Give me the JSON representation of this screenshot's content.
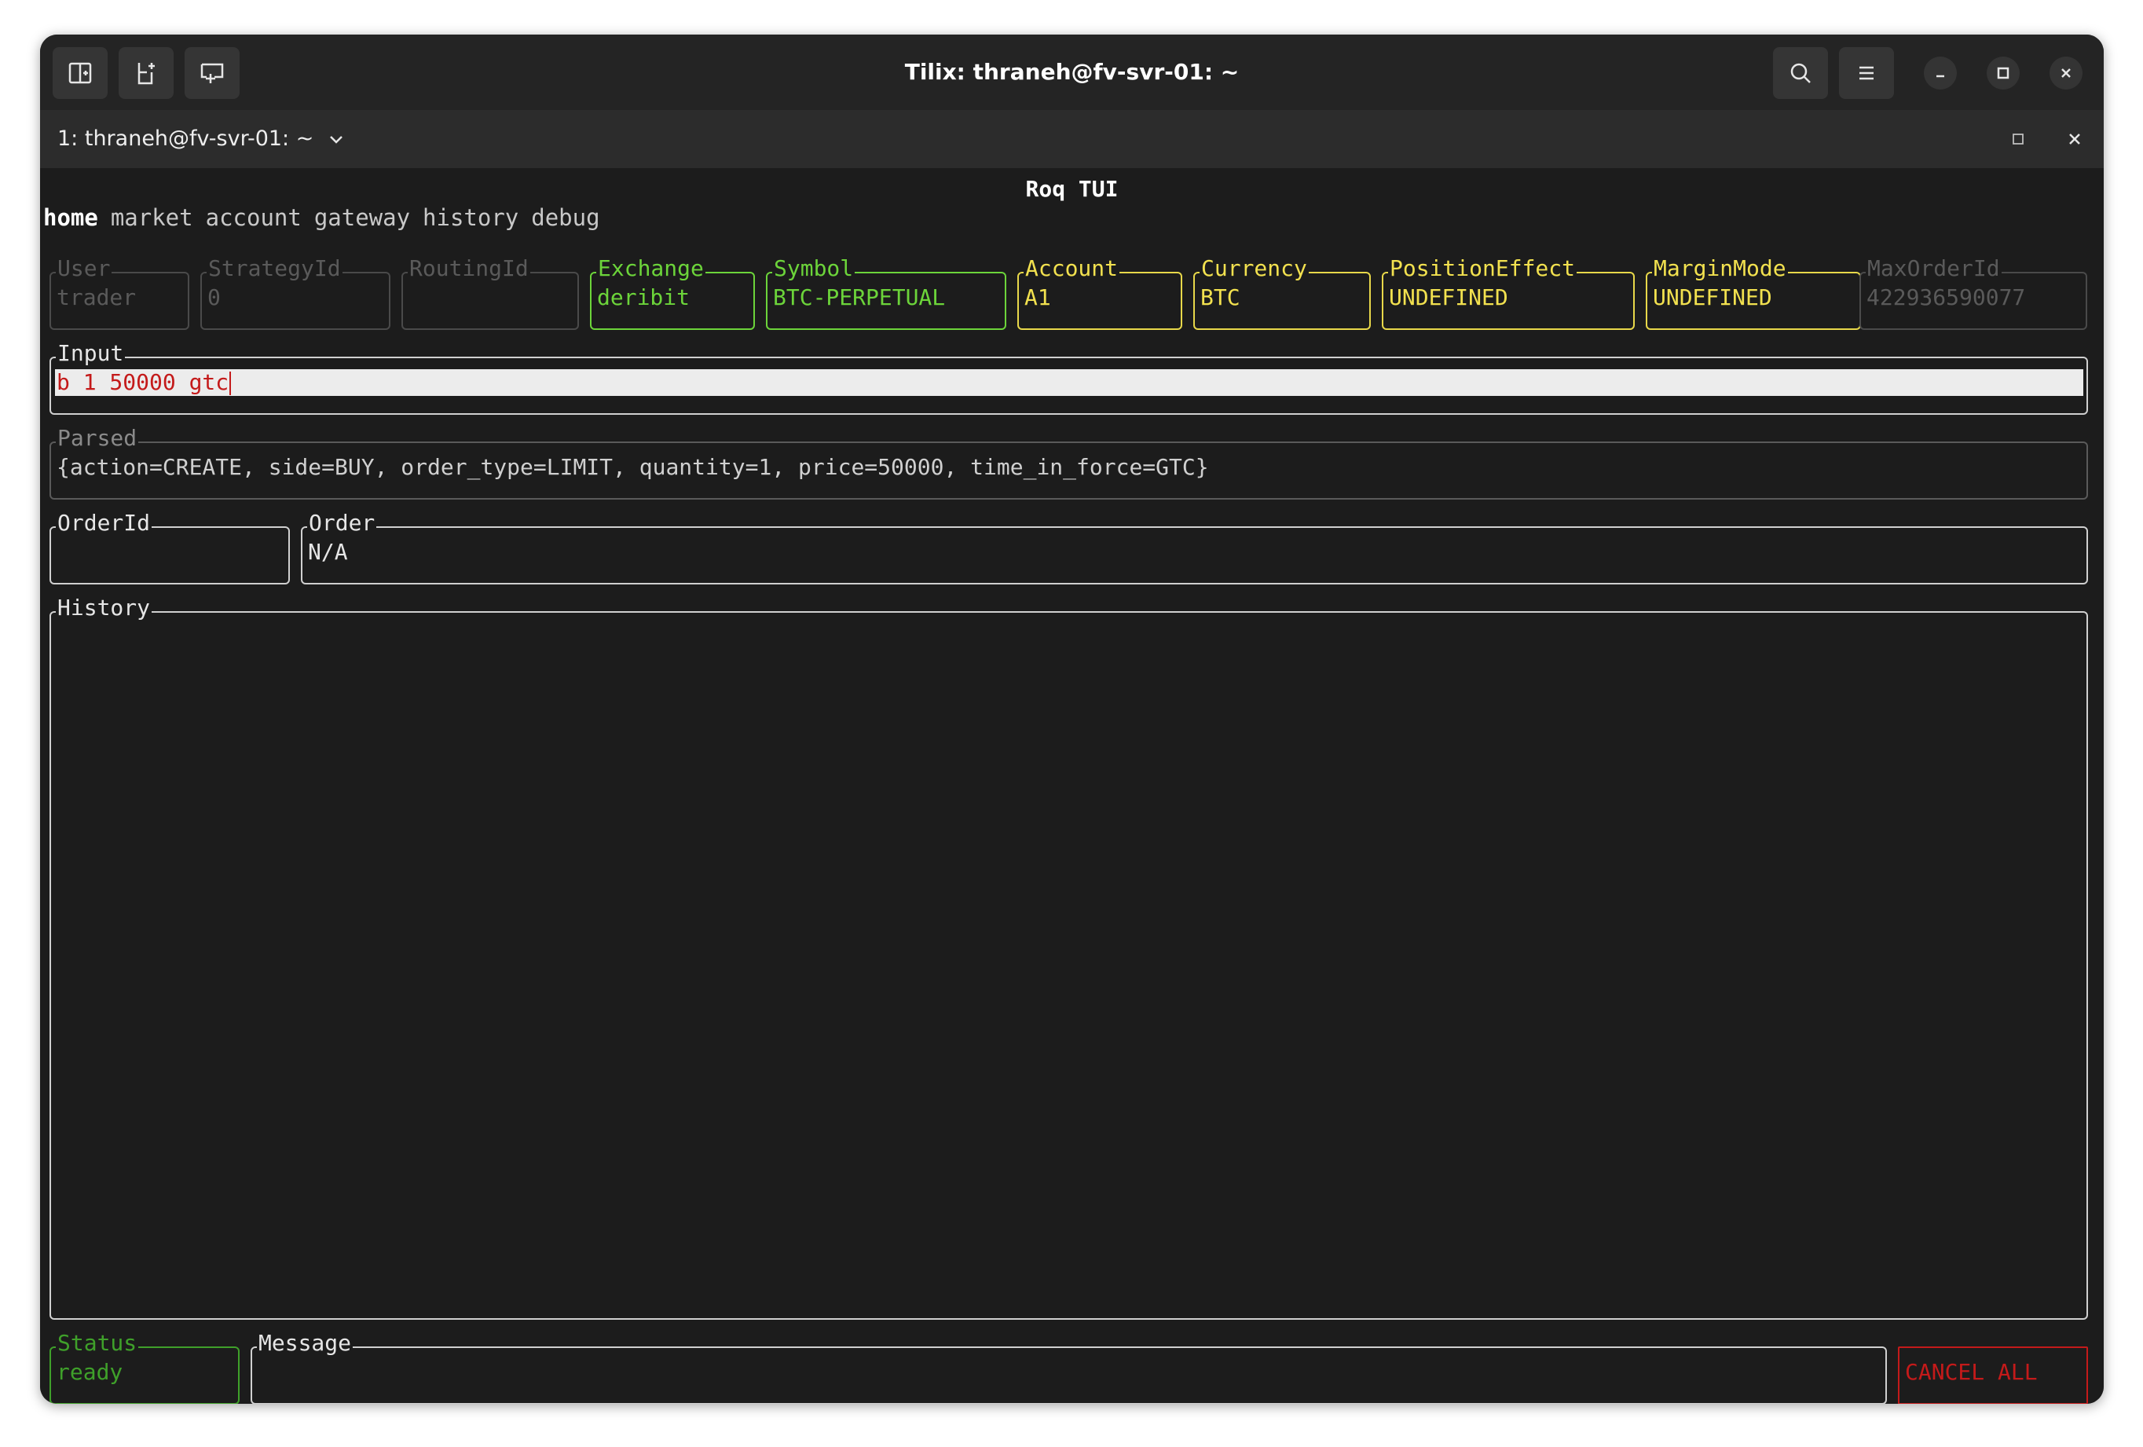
{
  "window": {
    "title": "Tilix: thraneh@fv-svr-01: ~"
  },
  "tab": {
    "label": "1: thraneh@fv-svr-01: ~"
  },
  "app": {
    "title": "Roq TUI",
    "nav": [
      "home",
      "market",
      "account",
      "gateway",
      "history",
      "debug"
    ],
    "active_nav": "home"
  },
  "fields": {
    "user": {
      "label": "User",
      "value": "trader"
    },
    "strategy_id": {
      "label": "StrategyId",
      "value": "0"
    },
    "routing_id": {
      "label": "RoutingId",
      "value": ""
    },
    "exchange": {
      "label": "Exchange",
      "value": "deribit"
    },
    "symbol": {
      "label": "Symbol",
      "value": "BTC-PERPETUAL"
    },
    "account": {
      "label": "Account",
      "value": "A1"
    },
    "currency": {
      "label": "Currency",
      "value": "BTC"
    },
    "position_effect": {
      "label": "PositionEffect",
      "value": "UNDEFINED"
    },
    "margin_mode": {
      "label": "MarginMode",
      "value": "UNDEFINED"
    },
    "max_order_id": {
      "label": "MaxOrderId",
      "value": "422936590077"
    }
  },
  "input": {
    "label": "Input",
    "value": "b 1 50000 gtc"
  },
  "parsed": {
    "label": "Parsed",
    "value": "{action=CREATE, side=BUY, order_type=LIMIT, quantity=1, price=50000, time_in_force=GTC}"
  },
  "order_id": {
    "label": "OrderId",
    "value": ""
  },
  "order": {
    "label": "Order",
    "value": "N/A"
  },
  "history": {
    "label": "History"
  },
  "status": {
    "label": "Status",
    "value": "ready"
  },
  "message": {
    "label": "Message",
    "value": ""
  },
  "cancel_all": {
    "label": "CANCEL ALL"
  },
  "colors": {
    "green": "#6cd43a",
    "yellow": "#f2e14f",
    "red": "#c41a1a",
    "status_green": "#3fa02a",
    "background": "#1c1c1c"
  }
}
